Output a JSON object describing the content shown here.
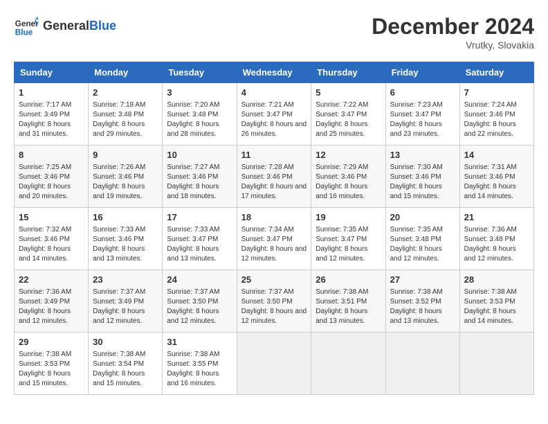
{
  "header": {
    "logo_general": "General",
    "logo_blue": "Blue",
    "month_title": "December 2024",
    "location": "Vrutky, Slovakia"
  },
  "days_of_week": [
    "Sunday",
    "Monday",
    "Tuesday",
    "Wednesday",
    "Thursday",
    "Friday",
    "Saturday"
  ],
  "weeks": [
    [
      {
        "day": "1",
        "sunrise": "7:17 AM",
        "sunset": "3:49 PM",
        "daylight": "8 hours and 31 minutes."
      },
      {
        "day": "2",
        "sunrise": "7:18 AM",
        "sunset": "3:48 PM",
        "daylight": "8 hours and 29 minutes."
      },
      {
        "day": "3",
        "sunrise": "7:20 AM",
        "sunset": "3:48 PM",
        "daylight": "8 hours and 28 minutes."
      },
      {
        "day": "4",
        "sunrise": "7:21 AM",
        "sunset": "3:47 PM",
        "daylight": "8 hours and 26 minutes."
      },
      {
        "day": "5",
        "sunrise": "7:22 AM",
        "sunset": "3:47 PM",
        "daylight": "8 hours and 25 minutes."
      },
      {
        "day": "6",
        "sunrise": "7:23 AM",
        "sunset": "3:47 PM",
        "daylight": "8 hours and 23 minutes."
      },
      {
        "day": "7",
        "sunrise": "7:24 AM",
        "sunset": "3:46 PM",
        "daylight": "8 hours and 22 minutes."
      }
    ],
    [
      {
        "day": "8",
        "sunrise": "7:25 AM",
        "sunset": "3:46 PM",
        "daylight": "8 hours and 20 minutes."
      },
      {
        "day": "9",
        "sunrise": "7:26 AM",
        "sunset": "3:46 PM",
        "daylight": "8 hours and 19 minutes."
      },
      {
        "day": "10",
        "sunrise": "7:27 AM",
        "sunset": "3:46 PM",
        "daylight": "8 hours and 18 minutes."
      },
      {
        "day": "11",
        "sunrise": "7:28 AM",
        "sunset": "3:46 PM",
        "daylight": "8 hours and 17 minutes."
      },
      {
        "day": "12",
        "sunrise": "7:29 AM",
        "sunset": "3:46 PM",
        "daylight": "8 hours and 16 minutes."
      },
      {
        "day": "13",
        "sunrise": "7:30 AM",
        "sunset": "3:46 PM",
        "daylight": "8 hours and 15 minutes."
      },
      {
        "day": "14",
        "sunrise": "7:31 AM",
        "sunset": "3:46 PM",
        "daylight": "8 hours and 14 minutes."
      }
    ],
    [
      {
        "day": "15",
        "sunrise": "7:32 AM",
        "sunset": "3:46 PM",
        "daylight": "8 hours and 14 minutes."
      },
      {
        "day": "16",
        "sunrise": "7:33 AM",
        "sunset": "3:46 PM",
        "daylight": "8 hours and 13 minutes."
      },
      {
        "day": "17",
        "sunrise": "7:33 AM",
        "sunset": "3:47 PM",
        "daylight": "8 hours and 13 minutes."
      },
      {
        "day": "18",
        "sunrise": "7:34 AM",
        "sunset": "3:47 PM",
        "daylight": "8 hours and 12 minutes."
      },
      {
        "day": "19",
        "sunrise": "7:35 AM",
        "sunset": "3:47 PM",
        "daylight": "8 hours and 12 minutes."
      },
      {
        "day": "20",
        "sunrise": "7:35 AM",
        "sunset": "3:48 PM",
        "daylight": "8 hours and 12 minutes."
      },
      {
        "day": "21",
        "sunrise": "7:36 AM",
        "sunset": "3:48 PM",
        "daylight": "8 hours and 12 minutes."
      }
    ],
    [
      {
        "day": "22",
        "sunrise": "7:36 AM",
        "sunset": "3:49 PM",
        "daylight": "8 hours and 12 minutes."
      },
      {
        "day": "23",
        "sunrise": "7:37 AM",
        "sunset": "3:49 PM",
        "daylight": "8 hours and 12 minutes."
      },
      {
        "day": "24",
        "sunrise": "7:37 AM",
        "sunset": "3:50 PM",
        "daylight": "8 hours and 12 minutes."
      },
      {
        "day": "25",
        "sunrise": "7:37 AM",
        "sunset": "3:50 PM",
        "daylight": "8 hours and 12 minutes."
      },
      {
        "day": "26",
        "sunrise": "7:38 AM",
        "sunset": "3:51 PM",
        "daylight": "8 hours and 13 minutes."
      },
      {
        "day": "27",
        "sunrise": "7:38 AM",
        "sunset": "3:52 PM",
        "daylight": "8 hours and 13 minutes."
      },
      {
        "day": "28",
        "sunrise": "7:38 AM",
        "sunset": "3:53 PM",
        "daylight": "8 hours and 14 minutes."
      }
    ],
    [
      {
        "day": "29",
        "sunrise": "7:38 AM",
        "sunset": "3:53 PM",
        "daylight": "8 hours and 15 minutes."
      },
      {
        "day": "30",
        "sunrise": "7:38 AM",
        "sunset": "3:54 PM",
        "daylight": "8 hours and 15 minutes."
      },
      {
        "day": "31",
        "sunrise": "7:38 AM",
        "sunset": "3:55 PM",
        "daylight": "8 hours and 16 minutes."
      },
      null,
      null,
      null,
      null
    ]
  ],
  "labels": {
    "sunrise": "Sunrise:",
    "sunset": "Sunset:",
    "daylight": "Daylight:"
  }
}
